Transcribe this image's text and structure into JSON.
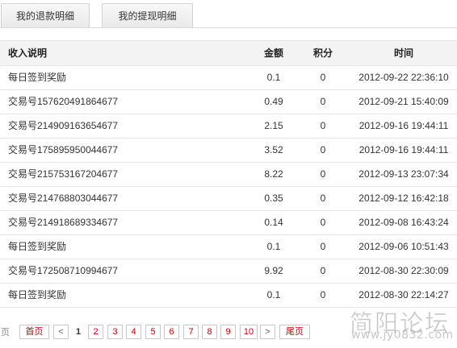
{
  "tabs": [
    {
      "label": "我的退款明细"
    },
    {
      "label": "我的提现明细"
    }
  ],
  "table": {
    "headers": {
      "desc": "收入说明",
      "amount": "金额",
      "points": "积分",
      "time": "时间"
    },
    "rows": [
      {
        "desc": "每日签到奖励",
        "amount": "0.1",
        "points": "0",
        "time": "2012-09-22 22:36:10"
      },
      {
        "desc": "交易号157620491864677",
        "amount": "0.49",
        "points": "0",
        "time": "2012-09-21 15:40:09"
      },
      {
        "desc": "交易号214909163654677",
        "amount": "2.15",
        "points": "0",
        "time": "2012-09-16 19:44:11"
      },
      {
        "desc": "交易号175895950044677",
        "amount": "3.52",
        "points": "0",
        "time": "2012-09-16 19:44:11"
      },
      {
        "desc": "交易号215753167204677",
        "amount": "8.22",
        "points": "0",
        "time": "2012-09-13 23:07:34"
      },
      {
        "desc": "交易号214768803044677",
        "amount": "0.35",
        "points": "0",
        "time": "2012-09-12 16:42:18"
      },
      {
        "desc": "交易号214918689334677",
        "amount": "0.14",
        "points": "0",
        "time": "2012-09-08 16:43:24"
      },
      {
        "desc": "每日签到奖励",
        "amount": "0.1",
        "points": "0",
        "time": "2012-09-06 10:51:43"
      },
      {
        "desc": "交易号172508710994677",
        "amount": "9.92",
        "points": "0",
        "time": "2012-08-30 22:30:09"
      },
      {
        "desc": "每日签到奖励",
        "amount": "0.1",
        "points": "0",
        "time": "2012-08-30 22:14:27"
      }
    ]
  },
  "pager": {
    "lead": "页",
    "first": "首页",
    "prev": "<",
    "pages": [
      "1",
      "2",
      "3",
      "4",
      "5",
      "6",
      "7",
      "8",
      "9",
      "10"
    ],
    "current": "1",
    "next": ">",
    "last": "尾页"
  },
  "watermark": {
    "cn": "简阳论坛",
    "url": "www.jy0832.com"
  }
}
